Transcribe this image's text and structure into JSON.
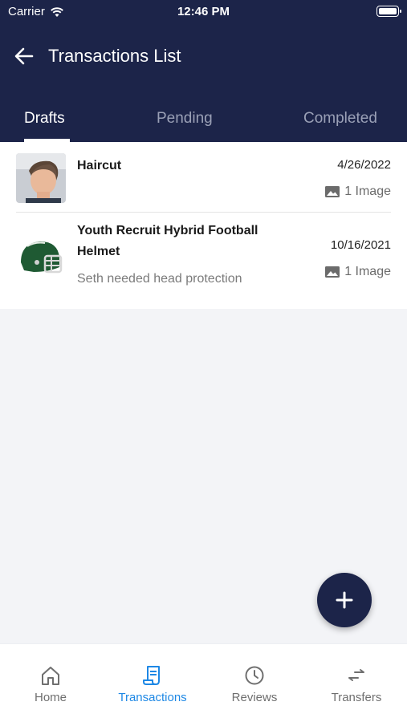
{
  "status": {
    "carrier": "Carrier",
    "time": "12:46 PM"
  },
  "header": {
    "title": "Transactions List"
  },
  "tabs": [
    {
      "label": "Drafts",
      "active": true
    },
    {
      "label": "Pending",
      "active": false
    },
    {
      "label": "Completed",
      "active": false
    }
  ],
  "transactions": [
    {
      "title": "Haircut",
      "description": "",
      "date": "4/26/2022",
      "images": "1 Image",
      "thumbnail": "haircut-photo"
    },
    {
      "title": "Youth Recruit Hybrid Football Helmet",
      "description": "Seth needed head protection",
      "date": "10/16/2021",
      "images": "1 Image",
      "thumbnail": "helmet-photo"
    }
  ],
  "fab": {
    "icon": "plus-icon"
  },
  "nav": [
    {
      "label": "Home",
      "icon": "home-icon",
      "active": false
    },
    {
      "label": "Transactions",
      "icon": "receipt-icon",
      "active": true
    },
    {
      "label": "Reviews",
      "icon": "clock-icon",
      "active": false
    },
    {
      "label": "Transfers",
      "icon": "transfer-icon",
      "active": false
    }
  ],
  "colors": {
    "header": "#1c2449",
    "accent": "#1e88e5",
    "background": "#f3f4f7"
  }
}
